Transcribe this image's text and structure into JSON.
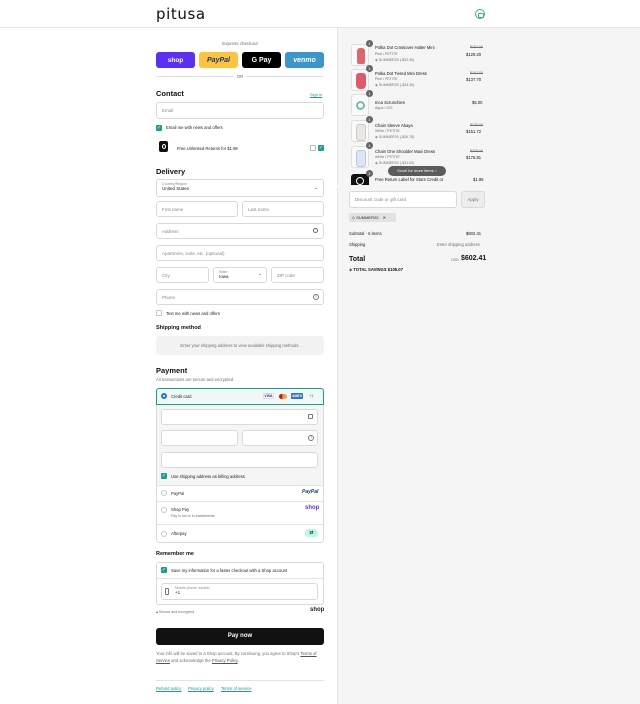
{
  "header": {
    "logo": "pitusa"
  },
  "express": {
    "title": "Express checkout",
    "shop": "shop",
    "paypal": "PayPal",
    "gpay": "G Pay",
    "venmo": "venmo",
    "or": "OR"
  },
  "contact": {
    "title": "Contact",
    "sign_in": "Sign in",
    "email_placeholder": "Email",
    "email_offers": "Email me with news and offers",
    "returns": "Free Unlimited Returns for $1.98"
  },
  "delivery": {
    "title": "Delivery",
    "country_label": "Country/Region",
    "country_value": "United States",
    "first_name": "First name",
    "last_name": "Last name",
    "address": "Address",
    "apartment": "Apartment, suite, etc. (optional)",
    "city": "City",
    "state_label": "State",
    "state_value": "Iowa",
    "zip": "ZIP code",
    "phone": "Phone",
    "text_offers": "Text me with news and offers"
  },
  "shipping": {
    "title": "Shipping method",
    "message": "Enter your shipping address to view available shipping methods."
  },
  "payment": {
    "title": "Payment",
    "subtitle": "All transactions are secure and encrypted.",
    "credit_card": "Credit card",
    "visa": "VISA",
    "amex": "AMEX",
    "more_cards": "+1",
    "billing_same": "Use shipping address as billing address",
    "paypal": "PayPal",
    "paypal_logo": "PayPal",
    "shop_pay": "Shop Pay",
    "shop_pay_sub": "Pay in full or in installments",
    "shop_pay_logo": "shop",
    "afterpay": "Afterpay"
  },
  "remember": {
    "title": "Remember me",
    "save_info": "Save my information for a faster checkout with a Shop account",
    "phone_label": "Mobile phone number",
    "phone_value": "+1",
    "secure": "Secure and encrypted",
    "shop_logo": "shop"
  },
  "pay": {
    "button": "Pay now",
    "legal_1": "Your info will be saved to a Shop account. By continuing, you agree to Shop's",
    "tos": "Terms of Service",
    "legal_2": "and acknowledge the",
    "privacy": "Privacy Policy",
    "legal_end": "."
  },
  "footer": {
    "refund": "Refund policy",
    "privacy": "Privacy policy",
    "terms": "Terms of service"
  },
  "summary": {
    "items": [
      {
        "name": "Polka Dot Crossover Halter Mini",
        "variant": "Pink / PETITE",
        "discount": "SUMMER20 (-$32.30)",
        "old_price": "$162.00",
        "price": "$129.20",
        "qty": "1"
      },
      {
        "name": "Polka Dot Tiered Mini Dress",
        "variant": "Pink / PETITE",
        "discount": "SUMMER20 (-$34.30)",
        "old_price": "$162.00",
        "price": "$137.70",
        "qty": "1"
      },
      {
        "name": "Inca Scrunchies",
        "variant": "Aqua / O/S",
        "discount": "",
        "old_price": "",
        "price": "$5.00",
        "qty": "1"
      },
      {
        "name": "Chain Sleeve Abaya",
        "variant": "White / PETITE",
        "discount": "SUMMER20 (-$26.78)",
        "old_price": "$178.00",
        "price": "$151.72",
        "qty": "1"
      },
      {
        "name": "Chain One Shoulder Maxi Dress",
        "variant": "White / PETITE",
        "discount": "SUMMER20 (-$31.00)",
        "old_price": "$209.00",
        "price": "$176.81",
        "qty": "1"
      },
      {
        "name": "Free Return Label for Store Credit or",
        "variant": "",
        "discount": "",
        "old_price": "",
        "price": "$1.99",
        "qty": "1"
      }
    ],
    "scroll_hint": "Scroll for more items",
    "discount_placeholder": "Discount code or gift card",
    "apply": "Apply",
    "applied_code": "SUMMER20",
    "subtotal_label": "Subtotal · 6 items",
    "subtotal_value": "$602.41",
    "shipping_label": "Shipping",
    "shipping_value": "Enter shipping address",
    "total_label": "Total",
    "currency": "USD",
    "total_value": "$602.41",
    "savings_label": "TOTAL SAVINGS",
    "savings_value": "$105.07"
  },
  "colors": {
    "accent": "#1a9e90",
    "shop": "#5a31f4",
    "paypal": "#ffc439",
    "venmo": "#3d95ce",
    "paybutton": "#111111"
  }
}
